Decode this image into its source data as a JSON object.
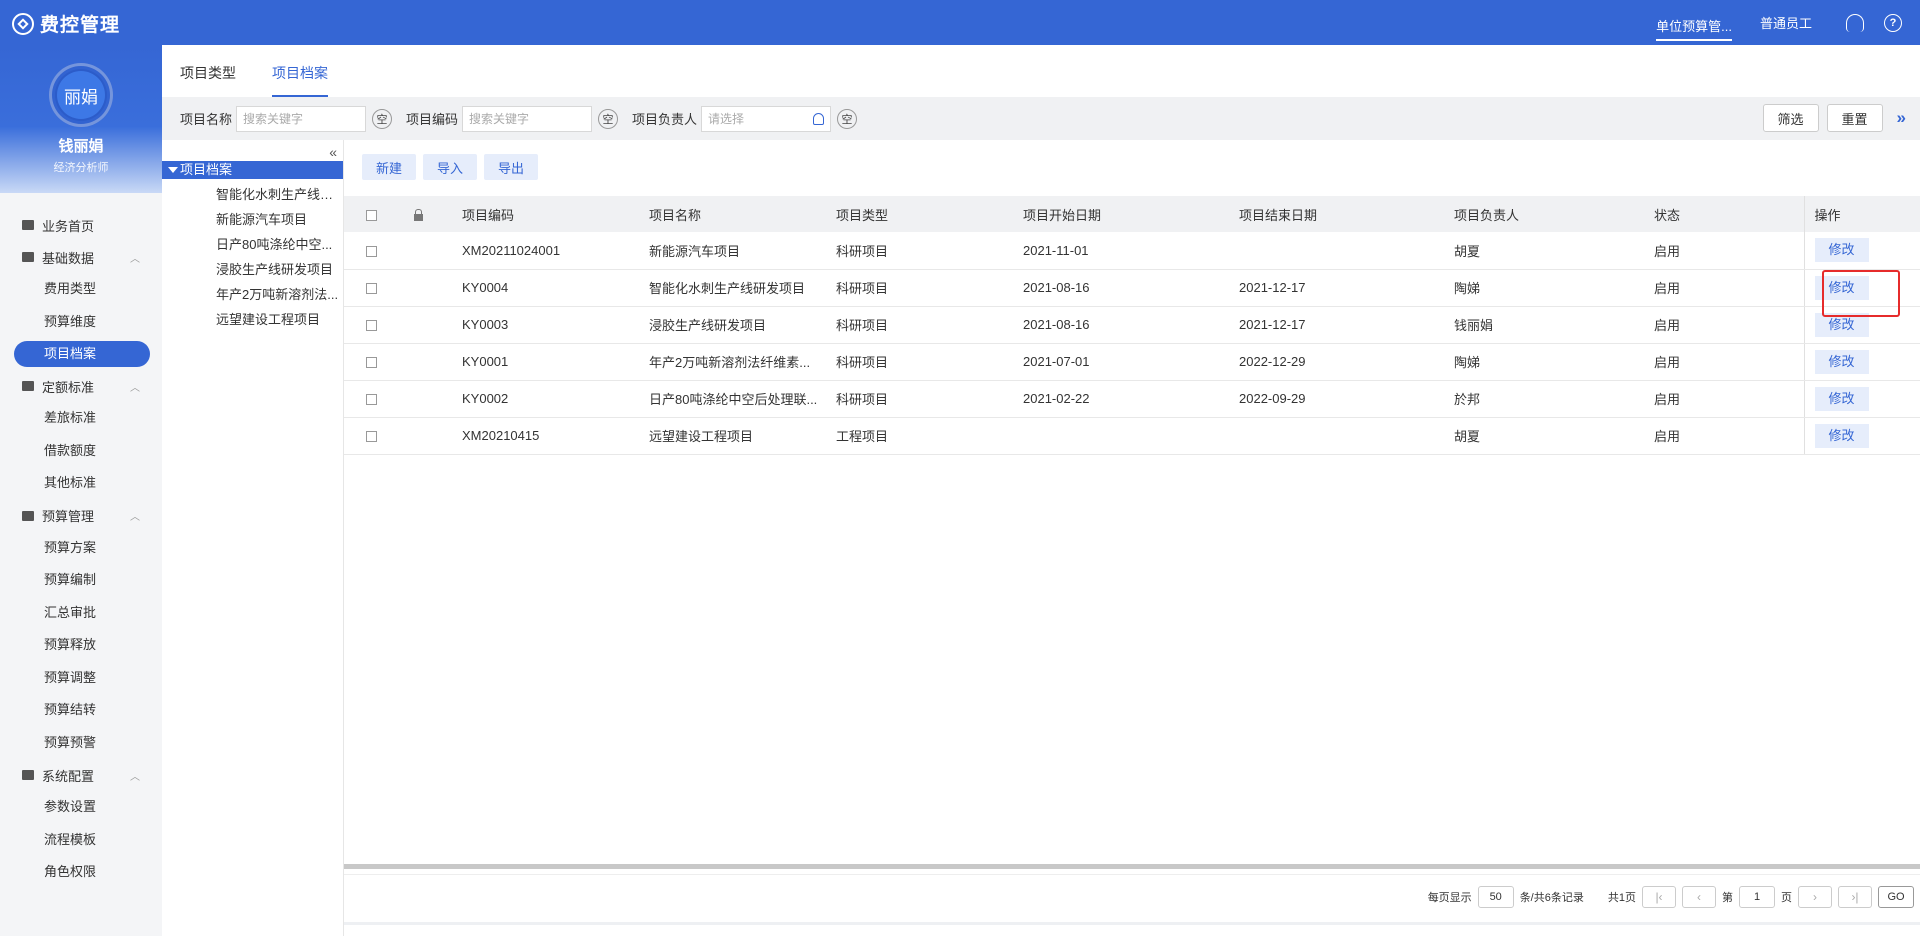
{
  "app": {
    "title": "费控管理"
  },
  "topbar": {
    "budget_link": "单位预算管...",
    "role_link": "普通员工",
    "help_icon": "?"
  },
  "profile": {
    "avatar_text": "丽娟",
    "name": "钱丽娟",
    "title": "经济分析师"
  },
  "sidebar": {
    "home": "业务首页",
    "groups": [
      {
        "label": "基础数据",
        "items": [
          "费用类型",
          "预算维度",
          "项目档案"
        ]
      },
      {
        "label": "定额标准",
        "items": [
          "差旅标准",
          "借款额度",
          "其他标准"
        ]
      },
      {
        "label": "预算管理",
        "items": [
          "预算方案",
          "预算编制",
          "汇总审批",
          "预算释放",
          "预算调整",
          "预算结转",
          "预算预警"
        ]
      },
      {
        "label": "系统配置",
        "items": [
          "参数设置",
          "流程模板",
          "角色权限"
        ]
      }
    ]
  },
  "tabs": [
    "项目类型",
    "项目档案"
  ],
  "filters": {
    "name_label": "项目名称",
    "name_placeholder": "搜索关键字",
    "code_label": "项目编码",
    "code_placeholder": "搜索关键字",
    "owner_label": "项目负责人",
    "owner_placeholder": "请选择",
    "clear": "空",
    "filter_btn": "筛选",
    "reset_btn": "重置"
  },
  "tree": {
    "root": "项目档案",
    "children": [
      "智能化水刺生产线研...",
      "新能源汽车项目",
      "日产80吨涤纶中空...",
      "浸胶生产线研发项目",
      "年产2万吨新溶剂法...",
      "远望建设工程项目"
    ]
  },
  "actions": {
    "new": "新建",
    "import": "导入",
    "export": "导出"
  },
  "table": {
    "headers": [
      "项目编码",
      "项目名称",
      "项目类型",
      "项目开始日期",
      "项目结束日期",
      "项目负责人",
      "状态",
      "操作"
    ],
    "edit_label": "修改",
    "rows": [
      {
        "code": "XM20211024001",
        "name": "新能源汽车项目",
        "type": "科研项目",
        "start": "2021-11-01",
        "end": "",
        "owner": "胡夏",
        "status": "启用"
      },
      {
        "code": "KY0004",
        "name": "智能化水刺生产线研发项目",
        "type": "科研项目",
        "start": "2021-08-16",
        "end": "2021-12-17",
        "owner": "陶娣",
        "status": "启用"
      },
      {
        "code": "KY0003",
        "name": "浸胶生产线研发项目",
        "type": "科研项目",
        "start": "2021-08-16",
        "end": "2021-12-17",
        "owner": "钱丽娟",
        "status": "启用"
      },
      {
        "code": "KY0001",
        "name": "年产2万吨新溶剂法纤维素...",
        "type": "科研项目",
        "start": "2021-07-01",
        "end": "2022-12-29",
        "owner": "陶娣",
        "status": "启用"
      },
      {
        "code": "KY0002",
        "name": "日产80吨涤纶中空后处理联...",
        "type": "科研项目",
        "start": "2021-02-22",
        "end": "2022-09-29",
        "owner": "於邦",
        "status": "启用"
      },
      {
        "code": "XM20210415",
        "name": "远望建设工程项目",
        "type": "工程项目",
        "start": "",
        "end": "",
        "owner": "胡夏",
        "status": "启用"
      }
    ]
  },
  "pager": {
    "per_page_label": "每页显示",
    "per_page": "50",
    "total_text": "条/共6条记录",
    "pages_text": "共1页",
    "page_prefix": "第",
    "page": "1",
    "page_suffix": "页",
    "go": "GO"
  },
  "colors": {
    "primary": "#3566d4",
    "highlight": "#e62b2b"
  }
}
